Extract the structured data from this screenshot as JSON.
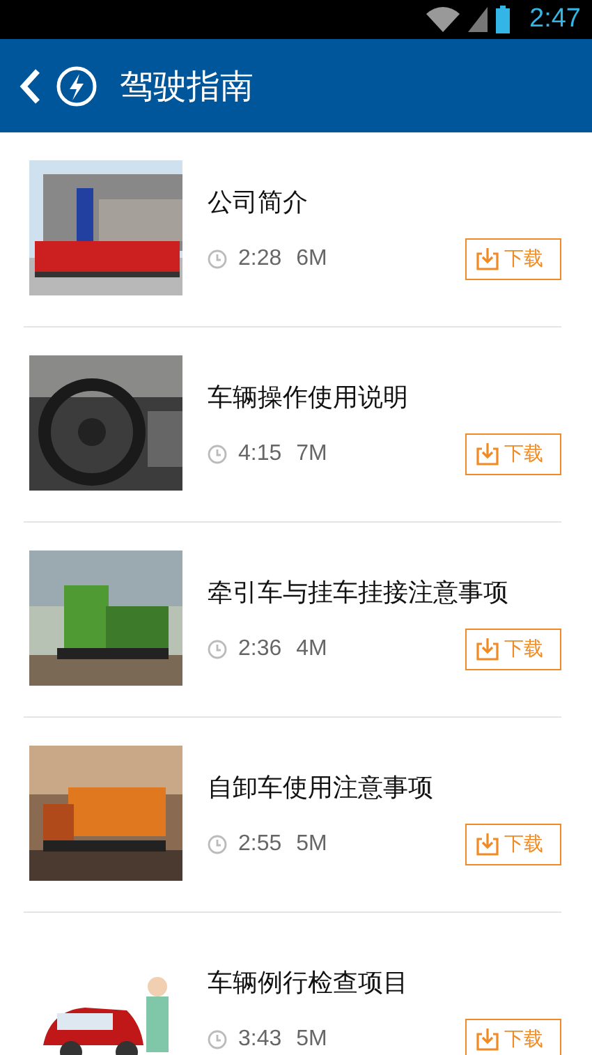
{
  "status_bar": {
    "time": "2:47"
  },
  "header": {
    "title": "驾驶指南"
  },
  "items": [
    {
      "title": "公司简介",
      "duration": "2:28",
      "size": "6M",
      "button": "下载"
    },
    {
      "title": "车辆操作使用说明",
      "duration": "4:15",
      "size": "7M",
      "button": "下载"
    },
    {
      "title": "牵引车与挂车挂接注意事项",
      "duration": "2:36",
      "size": "4M",
      "button": "下载"
    },
    {
      "title": "自卸车使用注意事项",
      "duration": "2:55",
      "size": "5M",
      "button": "下载"
    },
    {
      "title": "车辆例行检查项目",
      "duration": "3:43",
      "size": "5M",
      "button": "下载"
    }
  ]
}
